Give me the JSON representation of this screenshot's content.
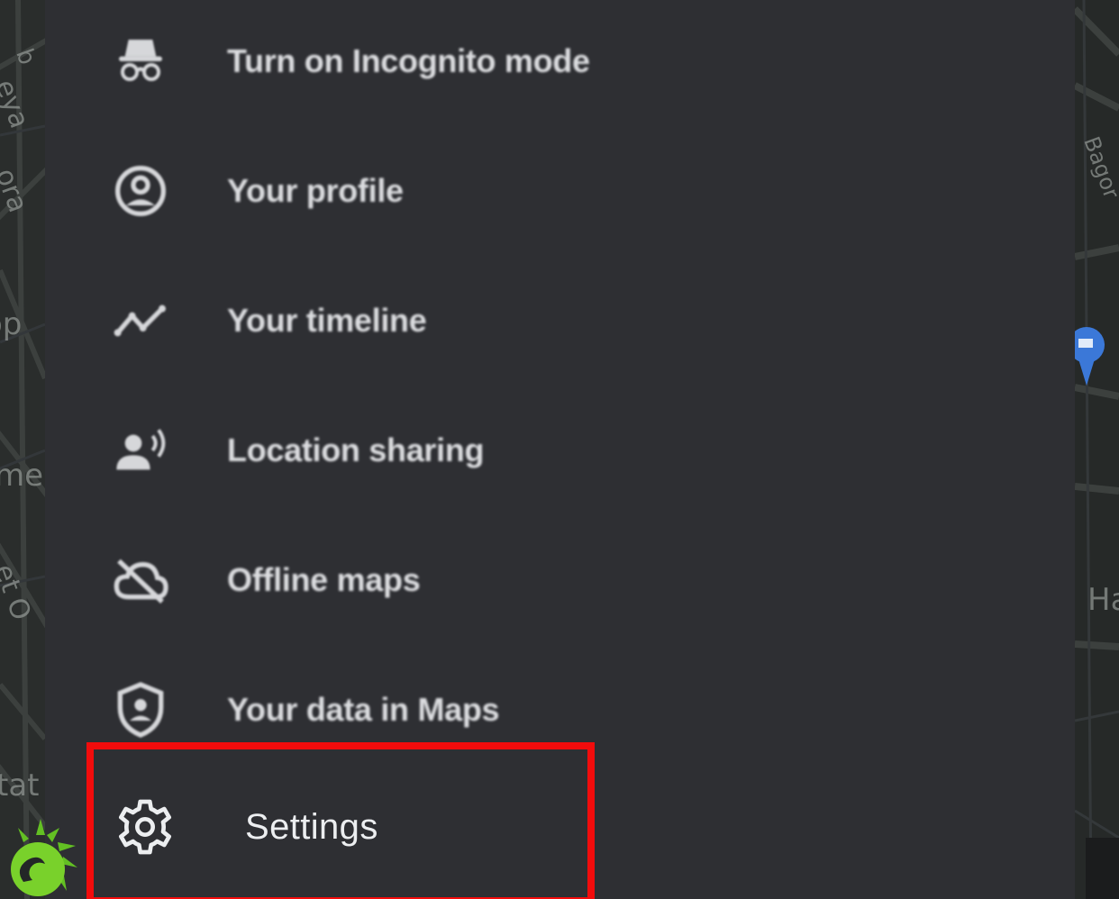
{
  "menu": {
    "items": [
      {
        "label": "Turn on Incognito mode",
        "icon": "incognito-icon"
      },
      {
        "label": "Your profile",
        "icon": "profile-icon"
      },
      {
        "label": "Your timeline",
        "icon": "timeline-icon"
      },
      {
        "label": "Location sharing",
        "icon": "location-sharing-icon"
      },
      {
        "label": "Offline maps",
        "icon": "offline-maps-icon"
      },
      {
        "label": "Your data in Maps",
        "icon": "data-shield-icon"
      },
      {
        "label": "Settings",
        "icon": "gear-icon"
      }
    ]
  },
  "map": {
    "left_labels": [
      "b",
      "eya",
      "ora",
      "op",
      "me",
      "et O",
      "tat"
    ],
    "right_labels": [
      "Bagor",
      "Ha"
    ]
  },
  "colors": {
    "drawer_bg": "#2e2f33",
    "text": "#dcdde0",
    "highlight": "#f20c0c",
    "map_bg": "#262928",
    "pin": "#3b78d8"
  }
}
